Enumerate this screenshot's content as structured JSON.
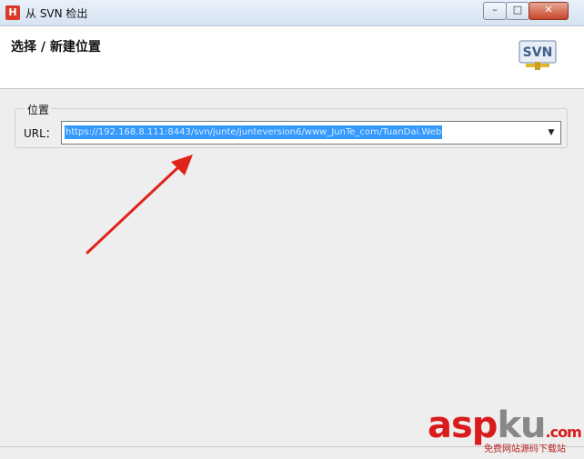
{
  "window": {
    "title": "从 SVN 检出",
    "app_icon_letter": "H",
    "minimize_glyph": "–",
    "maximize_glyph": "□",
    "close_glyph": "✕"
  },
  "header": {
    "title": "选择 / 新建位置",
    "logo_text": "SVN"
  },
  "location_group": {
    "label": "位置",
    "url_label": "URL：",
    "url_value": "https://192.168.8.111:8443/svn/junte/junteversion6/www_JunTe_com/TuanDai.Web"
  },
  "watermark": {
    "asp": "asp",
    "ku": "ku",
    "dot_com": ".com",
    "subtitle": "免费网站源码下载站"
  },
  "colors": {
    "selection": "#3399ff",
    "arrow": "#e0241c"
  }
}
